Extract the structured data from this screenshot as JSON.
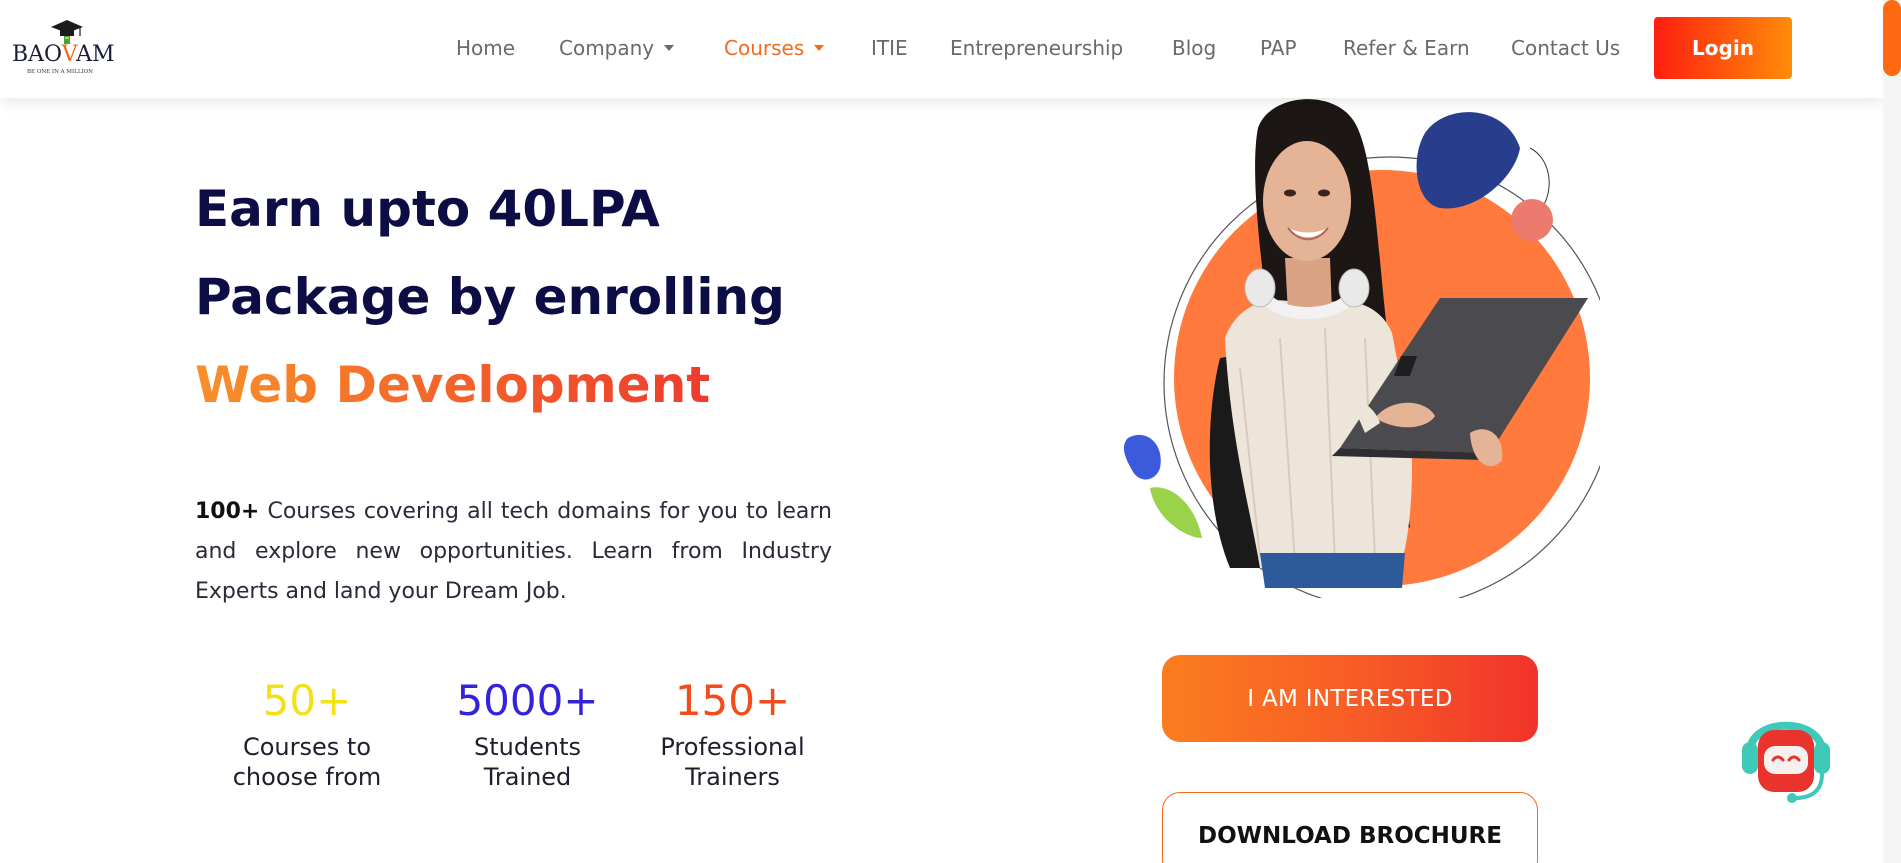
{
  "brand": {
    "logo_pre": "BAO",
    "logo_o": "V",
    "logo_post": "AM",
    "tagline": "BE ONE IN A MILLION"
  },
  "nav": {
    "items": [
      {
        "label": "Home"
      },
      {
        "label": "Company",
        "dropdown": true
      },
      {
        "label": "Courses",
        "dropdown": true,
        "active": true
      },
      {
        "label": "ITIE"
      },
      {
        "label": "Entrepreneurship"
      },
      {
        "label": "Blog"
      },
      {
        "label": "PAP"
      },
      {
        "label": "Refer & Earn"
      },
      {
        "label": "Contact Us"
      }
    ],
    "login_label": "Login"
  },
  "hero": {
    "line1": "Earn upto 40LPA",
    "line2": "Package by enrolling",
    "line3": "Web Development",
    "desc_bold": "100+",
    "desc_text": " Courses covering all tech domains for you to learn and explore new opportunities. Learn from Industry Experts and land your Dream Job."
  },
  "stats": [
    {
      "value": "50+",
      "label_line1": "Courses to",
      "label_line2": "choose from",
      "color": "#f2e01a"
    },
    {
      "value": "5000+",
      "label_line1": "Students",
      "label_line2": "Trained",
      "color": "#3323d9"
    },
    {
      "value": "150+",
      "label_line1": "Professional",
      "label_line2": "Trainers",
      "color": "#f24c1a"
    }
  ],
  "cta": {
    "interested": "I AM INTERESTED",
    "brochure": "DOWNLOAD BROCHURE"
  },
  "colors": {
    "accent_orange": "#f26b1d",
    "navy": "#0d0d45",
    "nav_text": "#6a6a6a"
  },
  "icons": {
    "logo": "graduation-cap-icon",
    "chatbot": "robot-headset-icon",
    "dropdown": "caret-down-icon"
  }
}
